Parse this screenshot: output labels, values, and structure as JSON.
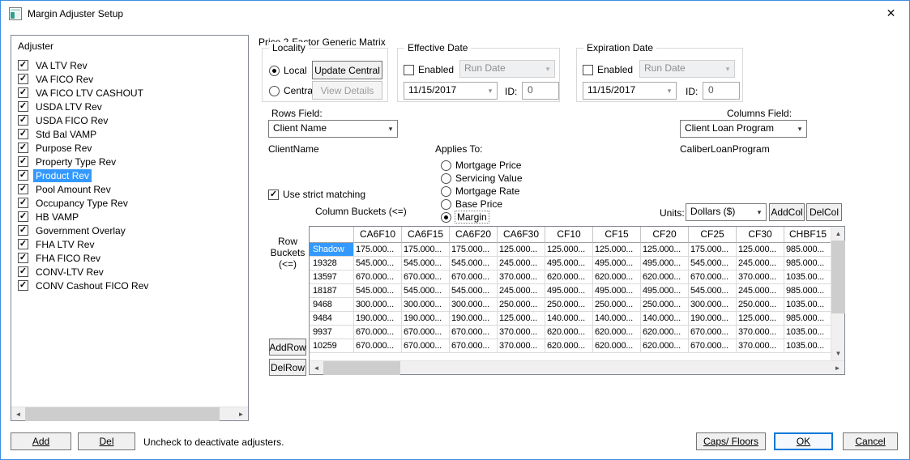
{
  "window": {
    "title": "Margin Adjuster Setup"
  },
  "icons": {
    "close": "✕",
    "check": "✓",
    "combo_arrow": "▾",
    "scroll_up": "▲",
    "scroll_down": "▼",
    "scroll_left": "◄",
    "scroll_right": "►"
  },
  "adjuster_panel": {
    "label": "Adjuster",
    "items": [
      {
        "label": "VA LTV Rev",
        "checked": true,
        "selected": false
      },
      {
        "label": "VA FICO Rev",
        "checked": true,
        "selected": false
      },
      {
        "label": "VA FICO LTV CASHOUT",
        "checked": true,
        "selected": false
      },
      {
        "label": "USDA LTV Rev",
        "checked": true,
        "selected": false
      },
      {
        "label": "USDA FICO Rev",
        "checked": true,
        "selected": false
      },
      {
        "label": "Std Bal VAMP",
        "checked": true,
        "selected": false
      },
      {
        "label": "Purpose Rev",
        "checked": true,
        "selected": false
      },
      {
        "label": "Property Type Rev",
        "checked": true,
        "selected": false
      },
      {
        "label": "Product Rev",
        "checked": true,
        "selected": true
      },
      {
        "label": "Pool Amount Rev",
        "checked": true,
        "selected": false
      },
      {
        "label": "Occupancy Type Rev",
        "checked": true,
        "selected": false
      },
      {
        "label": "HB VAMP",
        "checked": true,
        "selected": false
      },
      {
        "label": "Government Overlay",
        "checked": true,
        "selected": false
      },
      {
        "label": "FHA LTV Rev",
        "checked": true,
        "selected": false
      },
      {
        "label": "FHA FICO Rev",
        "checked": true,
        "selected": false
      },
      {
        "label": "CONV-LTV Rev",
        "checked": true,
        "selected": false
      },
      {
        "label": "CONV Cashout FICO Rev",
        "checked": true,
        "selected": false
      }
    ]
  },
  "matrix": {
    "title": "Price 2-Factor Generic Matrix",
    "locality": {
      "label": "Locality",
      "local_label": "Local",
      "central_label": "Central",
      "local_selected": true,
      "central_selected": false,
      "update_central": "Update Central",
      "view_details": "View Details"
    },
    "effective_date": {
      "label": "Effective Date",
      "enabled_label": "Enabled",
      "enabled": false,
      "mode": "Run Date",
      "date": "11/15/2017",
      "id_label": "ID:",
      "id_value": "0"
    },
    "expiration_date": {
      "label": "Expiration Date",
      "enabled_label": "Enabled",
      "enabled": false,
      "mode": "Run Date",
      "date": "11/15/2017",
      "id_label": "ID:",
      "id_value": "0"
    },
    "rows_field": {
      "label": "Rows Field:",
      "value": "Client Name",
      "bound_field": "ClientName"
    },
    "columns_field": {
      "label": "Columns Field:",
      "value": "Client Loan Program",
      "bound_field": "CaliberLoanProgram"
    },
    "applies_to": {
      "label": "Applies To:",
      "options": [
        "Mortgage Price",
        "Servicing Value",
        "Mortgage Rate",
        "Base Price",
        "Margin"
      ],
      "selected": "Margin"
    },
    "strict_matching": {
      "label": "Use strict matching",
      "checked": true
    },
    "column_buckets_label": "Column Buckets (<=)",
    "row_buckets_lines": [
      "Row",
      "Buckets",
      "(<=)"
    ],
    "units": {
      "label": "Units:",
      "value": "Dollars ($)"
    },
    "buttons": {
      "addcol": "AddCol",
      "delcol": "DelCol",
      "addrow": "AddRow",
      "delrow": "DelRow"
    },
    "table": {
      "columns": [
        "CA6F10",
        "CA6F15",
        "CA6F20",
        "CA6F30",
        "CF10",
        "CF15",
        "CF20",
        "CF25",
        "CF30",
        "CHBF15"
      ],
      "rows": [
        {
          "bucket": "Shadow",
          "selected": true,
          "values": [
            "175.000...",
            "175.000...",
            "175.000...",
            "125.000...",
            "125.000...",
            "125.000...",
            "125.000...",
            "175.000...",
            "125.000...",
            "985.000..."
          ]
        },
        {
          "bucket": "19328",
          "selected": false,
          "values": [
            "545.000...",
            "545.000...",
            "545.000...",
            "245.000...",
            "495.000...",
            "495.000...",
            "495.000...",
            "545.000...",
            "245.000...",
            "985.000..."
          ]
        },
        {
          "bucket": "13597",
          "selected": false,
          "values": [
            "670.000...",
            "670.000...",
            "670.000...",
            "370.000...",
            "620.000...",
            "620.000...",
            "620.000...",
            "670.000...",
            "370.000...",
            "1035.00..."
          ]
        },
        {
          "bucket": "18187",
          "selected": false,
          "values": [
            "545.000...",
            "545.000...",
            "545.000...",
            "245.000...",
            "495.000...",
            "495.000...",
            "495.000...",
            "545.000...",
            "245.000...",
            "985.000..."
          ]
        },
        {
          "bucket": "9468",
          "selected": false,
          "values": [
            "300.000...",
            "300.000...",
            "300.000...",
            "250.000...",
            "250.000...",
            "250.000...",
            "250.000...",
            "300.000...",
            "250.000...",
            "1035.00..."
          ]
        },
        {
          "bucket": "9484",
          "selected": false,
          "values": [
            "190.000...",
            "190.000...",
            "190.000...",
            "125.000...",
            "140.000...",
            "140.000...",
            "140.000...",
            "190.000...",
            "125.000...",
            "985.000..."
          ]
        },
        {
          "bucket": "9937",
          "selected": false,
          "values": [
            "670.000...",
            "670.000...",
            "670.000...",
            "370.000...",
            "620.000...",
            "620.000...",
            "620.000...",
            "670.000...",
            "370.000...",
            "1035.00..."
          ]
        },
        {
          "bucket": "10259",
          "selected": false,
          "values": [
            "670.000...",
            "670.000...",
            "670.000...",
            "370.000...",
            "620.000...",
            "620.000...",
            "620.000...",
            "670.000...",
            "370.000...",
            "1035.00..."
          ]
        }
      ]
    }
  },
  "footer": {
    "add": "Add",
    "del": "Del",
    "hint": "Uncheck to deactivate adjusters.",
    "caps_floors": "Caps/ Floors",
    "ok": "OK",
    "cancel": "Cancel"
  }
}
